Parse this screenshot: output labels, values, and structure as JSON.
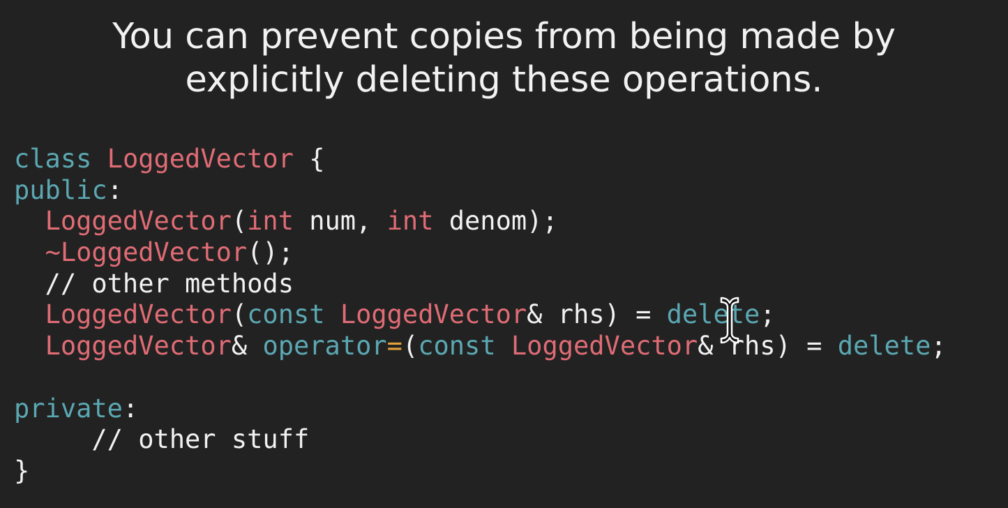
{
  "slide": {
    "title_lines": [
      "You can prevent copies from being made by",
      "explicitly deleting these operations."
    ]
  },
  "colors": {
    "background": "#222222",
    "text": "#f2f2f2",
    "keyword": "#5ba8b3",
    "type_name": "#e06c75",
    "operator": "#e5a03a",
    "comment": "#f2f2f2"
  },
  "code": {
    "lines": [
      [
        {
          "text": "class",
          "role": "keyword"
        },
        {
          "text": " ",
          "role": "text"
        },
        {
          "text": "LoggedVector",
          "role": "type_name"
        },
        {
          "text": " {",
          "role": "text"
        }
      ],
      [
        {
          "text": "public",
          "role": "keyword"
        },
        {
          "text": ":",
          "role": "text"
        }
      ],
      [
        {
          "text": "  ",
          "role": "text"
        },
        {
          "text": "LoggedVector",
          "role": "type_name"
        },
        {
          "text": "(",
          "role": "text"
        },
        {
          "text": "int",
          "role": "type_name"
        },
        {
          "text": " num, ",
          "role": "text"
        },
        {
          "text": "int",
          "role": "type_name"
        },
        {
          "text": " denom);",
          "role": "text"
        }
      ],
      [
        {
          "text": "  ",
          "role": "text"
        },
        {
          "text": "~LoggedVector",
          "role": "type_name"
        },
        {
          "text": "();",
          "role": "text"
        }
      ],
      [
        {
          "text": "  // other methods",
          "role": "comment"
        }
      ],
      [
        {
          "text": "  ",
          "role": "text"
        },
        {
          "text": "LoggedVector",
          "role": "type_name"
        },
        {
          "text": "(",
          "role": "text"
        },
        {
          "text": "const",
          "role": "keyword"
        },
        {
          "text": " ",
          "role": "text"
        },
        {
          "text": "LoggedVector",
          "role": "type_name"
        },
        {
          "text": "& rhs) = ",
          "role": "text"
        },
        {
          "text": "delete",
          "role": "keyword"
        },
        {
          "text": ";",
          "role": "text"
        }
      ],
      [
        {
          "text": "  ",
          "role": "text"
        },
        {
          "text": "LoggedVector",
          "role": "type_name"
        },
        {
          "text": "& ",
          "role": "text"
        },
        {
          "text": "operator",
          "role": "keyword"
        },
        {
          "text": "=",
          "role": "operator"
        },
        {
          "text": "(",
          "role": "text"
        },
        {
          "text": "const",
          "role": "keyword"
        },
        {
          "text": " ",
          "role": "text"
        },
        {
          "text": "LoggedVector",
          "role": "type_name"
        },
        {
          "text": "& rhs) = ",
          "role": "text"
        },
        {
          "text": "delete",
          "role": "keyword"
        },
        {
          "text": ";",
          "role": "text"
        }
      ],
      [
        {
          "text": "",
          "role": "text"
        }
      ],
      [
        {
          "text": "private",
          "role": "keyword"
        },
        {
          "text": ":",
          "role": "text"
        }
      ],
      [
        {
          "text": "     // other stuff",
          "role": "comment"
        }
      ],
      [
        {
          "text": "}",
          "role": "text"
        }
      ]
    ]
  },
  "cursor": {
    "icon": "text-cursor-ibeam-icon"
  }
}
